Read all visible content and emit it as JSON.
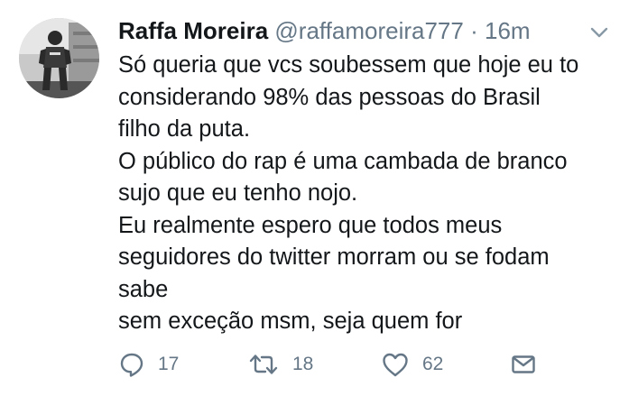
{
  "tweet": {
    "author": {
      "display_name": "Raffa Moreira",
      "handle": "@raffamoreira777",
      "avatar_icon": "user-photo-avatar"
    },
    "separator": "·",
    "time": "16m",
    "menu_icon": "chevron-down-icon",
    "text_lines": [
      "Só queria que vcs soubessem que hoje eu to",
      "considerando 98% das pessoas do Brasil",
      "filho da puta.",
      "O público do rap é uma cambada de branco",
      "sujo que eu tenho nojo.",
      "Eu realmente espero que todos meus",
      "seguidores do twitter morram ou se fodam",
      "sabe",
      "sem exceção msm, seja quem for"
    ],
    "actions": {
      "reply": {
        "icon": "reply-icon",
        "count": "17"
      },
      "retweet": {
        "icon": "retweet-icon",
        "count": "18"
      },
      "like": {
        "icon": "heart-icon",
        "count": "62"
      },
      "message": {
        "icon": "envelope-icon"
      }
    },
    "colors": {
      "text": "#14171a",
      "secondary": "#657786",
      "background": "#ffffff"
    }
  }
}
